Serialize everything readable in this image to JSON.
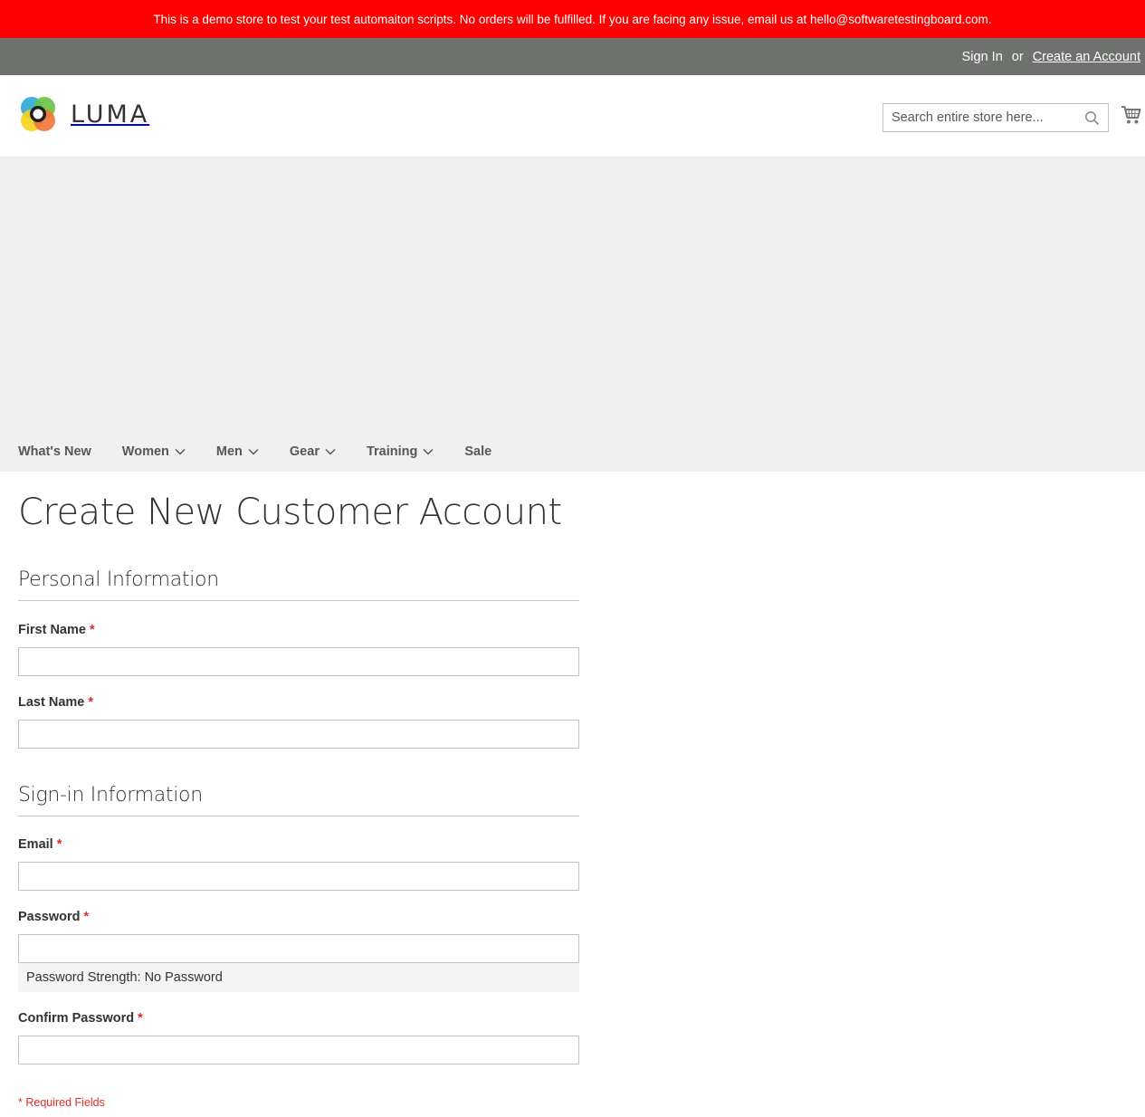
{
  "banner": {
    "text": "This is a demo store to test your test automaiton scripts. No orders will be fulfilled. If you are facing any issue, email us at hello@softwaretestingboard.com."
  },
  "panel": {
    "sign_in": "Sign In",
    "or": "or",
    "create_account": "Create an Account"
  },
  "header": {
    "logo_text": "LUMA",
    "search_placeholder": "Search entire store here...",
    "search_icon": "search-icon",
    "cart_icon": "cart-icon"
  },
  "nav": {
    "items": [
      {
        "label": "What's New",
        "has_dropdown": false
      },
      {
        "label": "Women",
        "has_dropdown": true
      },
      {
        "label": "Men",
        "has_dropdown": true
      },
      {
        "label": "Gear",
        "has_dropdown": true
      },
      {
        "label": "Training",
        "has_dropdown": true
      },
      {
        "label": "Sale",
        "has_dropdown": false
      }
    ]
  },
  "page": {
    "title": "Create New Customer Account"
  },
  "personal": {
    "legend": "Personal Information",
    "first_name_label": "First Name",
    "first_name_value": "",
    "last_name_label": "Last Name",
    "last_name_value": ""
  },
  "signin": {
    "legend": "Sign-in Information",
    "email_label": "Email",
    "email_value": "",
    "password_label": "Password",
    "password_value": "",
    "strength_text": "Password Strength: No Password",
    "confirm_label": "Confirm Password",
    "confirm_value": ""
  },
  "form": {
    "required_marker": "*",
    "required_note": "* Required Fields"
  },
  "colors": {
    "banner_bg": "#ff0000",
    "panel_bg": "#6e716e",
    "required": "#e02b27"
  }
}
